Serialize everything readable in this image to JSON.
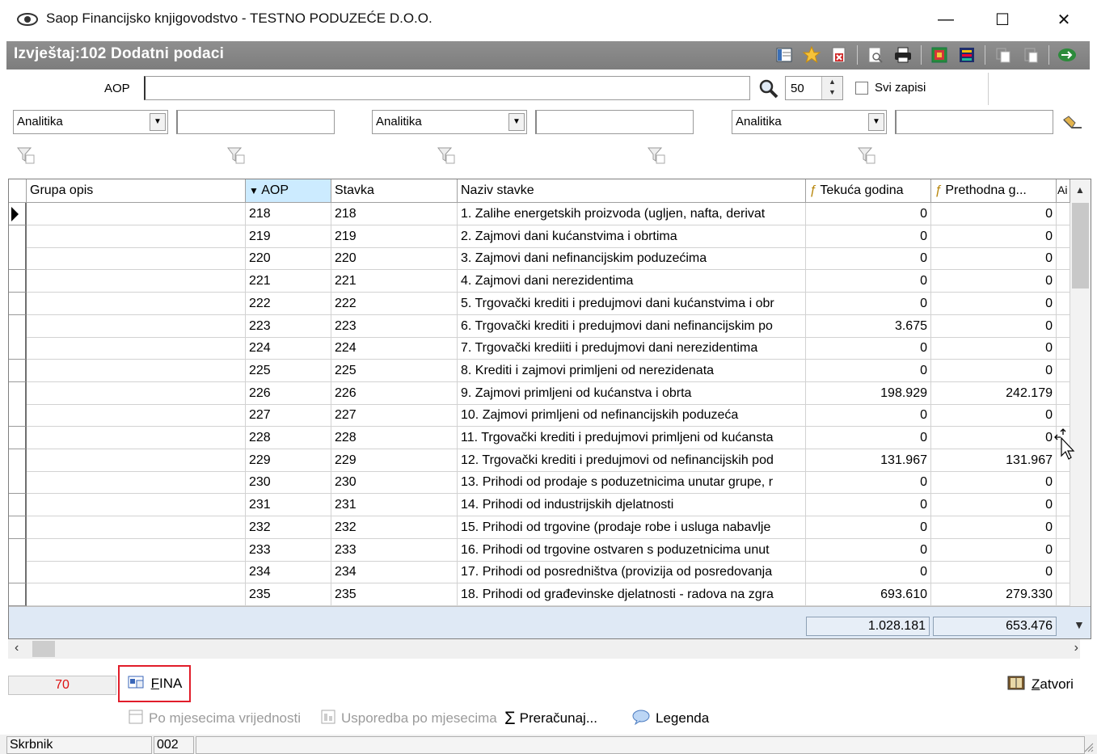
{
  "window": {
    "title": "Saop Financijsko knjigovodstvo - TESTNO PODUZEĆE D.O.O.",
    "minimize": "—",
    "maximize": "☐",
    "close": "✕"
  },
  "report": {
    "title": "Izvještaj:102 Dodatni podaci",
    "toolbar_icons": [
      "columns-icon",
      "favorite-star-icon",
      "delete-doc-icon",
      "preview-icon",
      "print-icon",
      "export-icon",
      "layout-icon",
      "copy-icon",
      "copy2-icon",
      "exit-icon"
    ]
  },
  "filters": {
    "aop_label": "AOP",
    "aop_value": "",
    "page_size": "50",
    "all_records_label": "Svi zapisi",
    "all_records_checked": false,
    "combos": [
      {
        "value": "Analitika",
        "text": ""
      },
      {
        "value": "Analitika",
        "text": ""
      },
      {
        "value": "Analitika",
        "text": ""
      }
    ]
  },
  "grid": {
    "columns": [
      "Grupa opis",
      "AOP",
      "Stavka",
      "Naziv stavke",
      "Tekuća godina",
      "Prethodna g...",
      "Ai"
    ],
    "sorted_column": "AOP",
    "rows": [
      {
        "grupa": "",
        "aop": "218",
        "stavka": "218",
        "naziv": "1. Zalihe energetskih proizvoda (ugljen, nafta, derivat",
        "tekuca": "0",
        "prethodna": "0"
      },
      {
        "grupa": "",
        "aop": "219",
        "stavka": "219",
        "naziv": "2. Zajmovi dani kućanstvima i obrtima",
        "tekuca": "0",
        "prethodna": "0"
      },
      {
        "grupa": "",
        "aop": "220",
        "stavka": "220",
        "naziv": "3. Zajmovi dani nefinancijskim poduzećima",
        "tekuca": "0",
        "prethodna": "0"
      },
      {
        "grupa": "",
        "aop": "221",
        "stavka": "221",
        "naziv": "4. Zajmovi dani nerezidentima",
        "tekuca": "0",
        "prethodna": "0"
      },
      {
        "grupa": "",
        "aop": "222",
        "stavka": "222",
        "naziv": "5. Trgovački krediti i predujmovi dani kućanstvima i obr",
        "tekuca": "0",
        "prethodna": "0"
      },
      {
        "grupa": "",
        "aop": "223",
        "stavka": "223",
        "naziv": "6. Trgovački krediti i predujmovi dani nefinancijskim po",
        "tekuca": "3.675",
        "prethodna": "0"
      },
      {
        "grupa": "",
        "aop": "224",
        "stavka": "224",
        "naziv": "7. Trgovački krediiti i predujmovi dani nerezidentima",
        "tekuca": "0",
        "prethodna": "0"
      },
      {
        "grupa": "",
        "aop": "225",
        "stavka": "225",
        "naziv": "8. Krediti i zajmovi primljeni od nerezidenata",
        "tekuca": "0",
        "prethodna": "0"
      },
      {
        "grupa": "",
        "aop": "226",
        "stavka": "226",
        "naziv": "9. Zajmovi primljeni od kućanstva i obrta",
        "tekuca": "198.929",
        "prethodna": "242.179"
      },
      {
        "grupa": "",
        "aop": "227",
        "stavka": "227",
        "naziv": "10. Zajmovi primljeni od nefinancijskih poduzeća",
        "tekuca": "0",
        "prethodna": "0"
      },
      {
        "grupa": "",
        "aop": "228",
        "stavka": "228",
        "naziv": "11. Trgovački krediti i predujmovi primljeni od kućansta",
        "tekuca": "0",
        "prethodna": "0"
      },
      {
        "grupa": "",
        "aop": "229",
        "stavka": "229",
        "naziv": "12. Trgovački krediti i predujmovi od nefinancijskih pod",
        "tekuca": "131.967",
        "prethodna": "131.967"
      },
      {
        "grupa": "",
        "aop": "230",
        "stavka": "230",
        "naziv": "13. Prihodi od prodaje s poduzetnicima unutar grupe, r",
        "tekuca": "0",
        "prethodna": "0"
      },
      {
        "grupa": "",
        "aop": "231",
        "stavka": "231",
        "naziv": "14. Prihodi od industrijskih djelatnosti",
        "tekuca": "0",
        "prethodna": "0"
      },
      {
        "grupa": "",
        "aop": "232",
        "stavka": "232",
        "naziv": "15. Prihodi od trgovine (prodaje robe i usluga nabavlje",
        "tekuca": "0",
        "prethodna": "0"
      },
      {
        "grupa": "",
        "aop": "233",
        "stavka": "233",
        "naziv": "16. Prihodi od trgovine ostvaren s poduzetnicima unut",
        "tekuca": "0",
        "prethodna": "0"
      },
      {
        "grupa": "",
        "aop": "234",
        "stavka": "234",
        "naziv": "17. Prihodi od posredništva (provizija od posredovanja",
        "tekuca": "0",
        "prethodna": "0"
      },
      {
        "grupa": "",
        "aop": "235",
        "stavka": "235",
        "naziv": "18. Prihodi od građevinske djelatnosti - radova na zgra",
        "tekuca": "693.610",
        "prethodna": "279.330"
      }
    ],
    "totals": {
      "tekuca": "1.028.181",
      "prethodna": "653.476"
    }
  },
  "bottom": {
    "record_count": "70",
    "fina_label": "FINA",
    "close_label": "Zatvori",
    "actions": [
      {
        "label": "Po mjesecima vrijednosti",
        "enabled": false
      },
      {
        "label": "Usporedba po mjesecima",
        "enabled": false
      },
      {
        "label": "Preračunaj...",
        "enabled": true
      },
      {
        "label": "Legenda",
        "enabled": true
      }
    ]
  },
  "status": {
    "user": "Skrbnik",
    "code": "002"
  }
}
